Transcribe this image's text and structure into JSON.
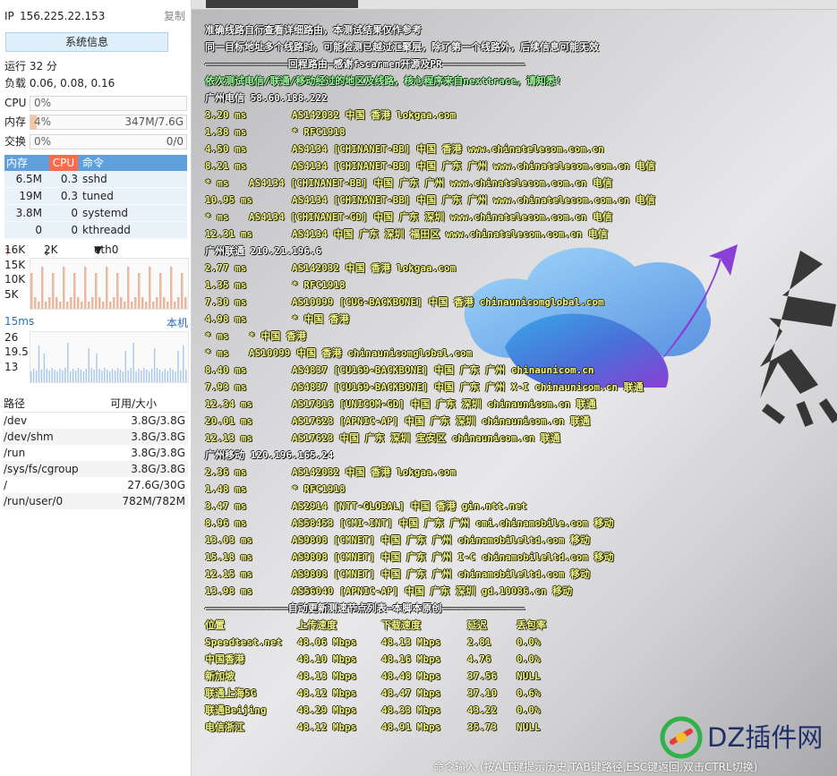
{
  "sidebar": {
    "ip_label": "IP",
    "ip": "156.225.22.153",
    "copy": "复制",
    "sysinfo_button": "系统信息",
    "uptime": "运行 32 分",
    "load": "负载 0.06, 0.08, 0.16",
    "cpu": {
      "label": "CPU",
      "pct": "0%",
      "fraction": 0.0
    },
    "mem": {
      "label": "内存",
      "pct": "4%",
      "amount": "347M/7.6G",
      "fraction": 0.04
    },
    "swap": {
      "label": "交换",
      "pct": "0%",
      "amount": "0/0",
      "fraction": 0.0
    },
    "proc_headers": {
      "mem": "内存",
      "cpu": "CPU",
      "cmd": "命令"
    },
    "processes": [
      {
        "mem": "6.5M",
        "cpu": "0.3",
        "cmd": "sshd"
      },
      {
        "mem": "19M",
        "cpu": "0.3",
        "cmd": "tuned"
      },
      {
        "mem": "3.8M",
        "cpu": "0",
        "cmd": "systemd"
      },
      {
        "mem": "0",
        "cpu": "0",
        "cmd": "kthreadd"
      }
    ],
    "net": {
      "up": "16K",
      "down": "2K",
      "iface": "eth0",
      "ticks": [
        "15K",
        "10K",
        "5K"
      ]
    },
    "latency": {
      "title": "15ms",
      "link": "本机",
      "ticks": [
        "26",
        "19.5",
        "13"
      ]
    },
    "disk_headers": {
      "path": "路径",
      "size": "可用/大小"
    },
    "disks": [
      {
        "path": "/dev",
        "size": "3.8G/3.8G"
      },
      {
        "path": "/dev/shm",
        "size": "3.8G/3.8G"
      },
      {
        "path": "/run",
        "size": "3.8G/3.8G"
      },
      {
        "path": "/sys/fs/cgroup",
        "size": "3.8G/3.8G"
      },
      {
        "path": "/",
        "size": "27.6G/30G"
      },
      {
        "path": "/run/user/0",
        "size": "782M/782M"
      }
    ]
  },
  "terminal": {
    "header_lines": [
      "准确线路自行查看详细路由，本测试结果仅作参考",
      "同一目标地址多个线路时，可能检测已越过汇聚层，除了第一个线路外，后续信息可能无效",
      "——————————————回程路由—感谢fscarmen开源及PR——————————————",
      "依次测试电信/联通/移动经过的地区及线路，核心程序来自nexttrace，请知悉!"
    ],
    "routes": [
      {
        "title": "广州电信 58.60.188.222",
        "hops": [
          {
            "ms": "3.20 ms",
            "info": "AS142032 中国 香港 lokgaa.com"
          },
          {
            "ms": "1.38 ms",
            "info": "* RFC1918"
          },
          {
            "ms": "4.50 ms",
            "info": "AS4134 [CHINANET-BB] 中国 香港 www.chinatelecom.com.cn"
          },
          {
            "ms": "8.21 ms",
            "info": "AS4134 [CHINANET-BB] 中国 广东 广州 www.chinatelecom.com.cn 电信"
          },
          {
            "ms": "* ms",
            "info": "AS4134 [CHINANET-BB] 中国 广东 广州 www.chinatelecom.com.cn 电信"
          },
          {
            "ms": "10.95 ms",
            "info": "AS4134 [CHINANET-BB] 中国 广东 广州 www.chinatelecom.com.cn 电信"
          },
          {
            "ms": "* ms",
            "info": "AS4134 [CHINANET-GD] 中国 广东 深圳 www.chinatelecom.com.cn 电信"
          },
          {
            "ms": "12.31 ms",
            "info": "AS4134 中国 广东 深圳 福田区 www.chinatelecom.com.cn 电信"
          }
        ]
      },
      {
        "title": "广州联通 210.21.196.6",
        "hops": [
          {
            "ms": "2.77 ms",
            "info": "AS142032 中国 香港 lokgaa.com"
          },
          {
            "ms": "1.35 ms",
            "info": "* RFC1918"
          },
          {
            "ms": "7.30 ms",
            "info": "AS10099 [CUG-BACKBONE] 中国 香港 chinaunicomglobal.com"
          },
          {
            "ms": "4.98 ms",
            "info": "* 中国 香港"
          },
          {
            "ms": "* ms",
            "info": "* 中国 香港"
          },
          {
            "ms": "* ms",
            "info": "AS10099 中国 香港 chinaunicomglobal.com"
          },
          {
            "ms": "8.40 ms",
            "info": "AS4837 [CU169-BACKBONE] 中国 广东 广州 chinaunicom.cn"
          },
          {
            "ms": "7.93 ms",
            "info": "AS4837 [CU169-BACKBONE] 中国 广东 广州 X-I chinaunicom.cn 联通"
          },
          {
            "ms": "12.34 ms",
            "info": "AS17816 [UNICOM-GD] 中国 广东 深圳 chinaunicom.cn 联通"
          },
          {
            "ms": "20.01 ms",
            "info": "AS17623 [APNIC-AP] 中国 广东 深圳 chinaunicom.cn 联通"
          },
          {
            "ms": "12.13 ms",
            "info": "AS17623 中国 广东 深圳 宝安区 chinaunicom.cn 联通"
          }
        ]
      },
      {
        "title": "广州移动 120.196.165.24",
        "hops": [
          {
            "ms": "2.36 ms",
            "info": "AS142032 中国 香港 lokgaa.com"
          },
          {
            "ms": "1.48 ms",
            "info": "* RFC1918"
          },
          {
            "ms": "3.47 ms",
            "info": "AS2914 [NTT-GLOBAL] 中国 香港 gin.ntt.net"
          },
          {
            "ms": "8.96 ms",
            "info": "AS58453 [CMI-INT] 中国 广东 广州 cmi.chinamobile.com 移动"
          },
          {
            "ms": "13.03 ms",
            "info": "AS9808 [CMNET] 中国 广东 广州 chinamobileltd.com 移动"
          },
          {
            "ms": "15.18 ms",
            "info": "AS9808 [CMNET] 中国 广东 广州 I-C chinamobileltd.com 移动"
          },
          {
            "ms": "12.15 ms",
            "info": "AS9808 [CMNET] 中国 广东 广州 chinamobileltd.com 移动"
          },
          {
            "ms": "13.98 ms",
            "info": "AS56040 [APNIC-AP] 中国 广东 深圳 gd.10086.cn 移动"
          }
        ]
      }
    ],
    "speed_banner": "——————————————自动更新测速节点列表—本脚本原创——————————————",
    "speed_headers": [
      "位置",
      "上传速度",
      "下载速度",
      "延迟",
      "丢包率"
    ],
    "speed_rows": [
      [
        "Speedtest.net",
        "48.06 Mbps",
        "48.13 Mbps",
        "2.81",
        "0.0%"
      ],
      [
        "中国香港",
        "48.10 Mbps",
        "48.16 Mbps",
        "4.76",
        "0.0%"
      ],
      [
        "新加坡",
        "48.13 Mbps",
        "48.48 Mbps",
        "37.56",
        "NULL"
      ],
      [
        "联通上海5G",
        "48.12 Mbps",
        "48.47 Mbps",
        "37.10",
        "0.6%"
      ],
      [
        "联通Beijing",
        "48.29 Mbps",
        "48.33 Mbps",
        "43.22",
        "0.0%"
      ],
      [
        "电信浙江",
        "48.12 Mbps",
        "48.91 Mbps",
        "35.73",
        "NULL"
      ]
    ],
    "cmd_hint": "命令输入 (按ALT键提示历史,TAB键路径,ESC键返回,双击CTRL切换)",
    "watermark": "DZ插件网"
  },
  "colors": {
    "term_text": "#f2f48a",
    "header_text": "#ffffff",
    "notice_text": "#9ff59f",
    "proc_header": "#5fa0dc",
    "cpu_header": "#ff6b4a",
    "mem_fill": "#f7c6a0"
  }
}
